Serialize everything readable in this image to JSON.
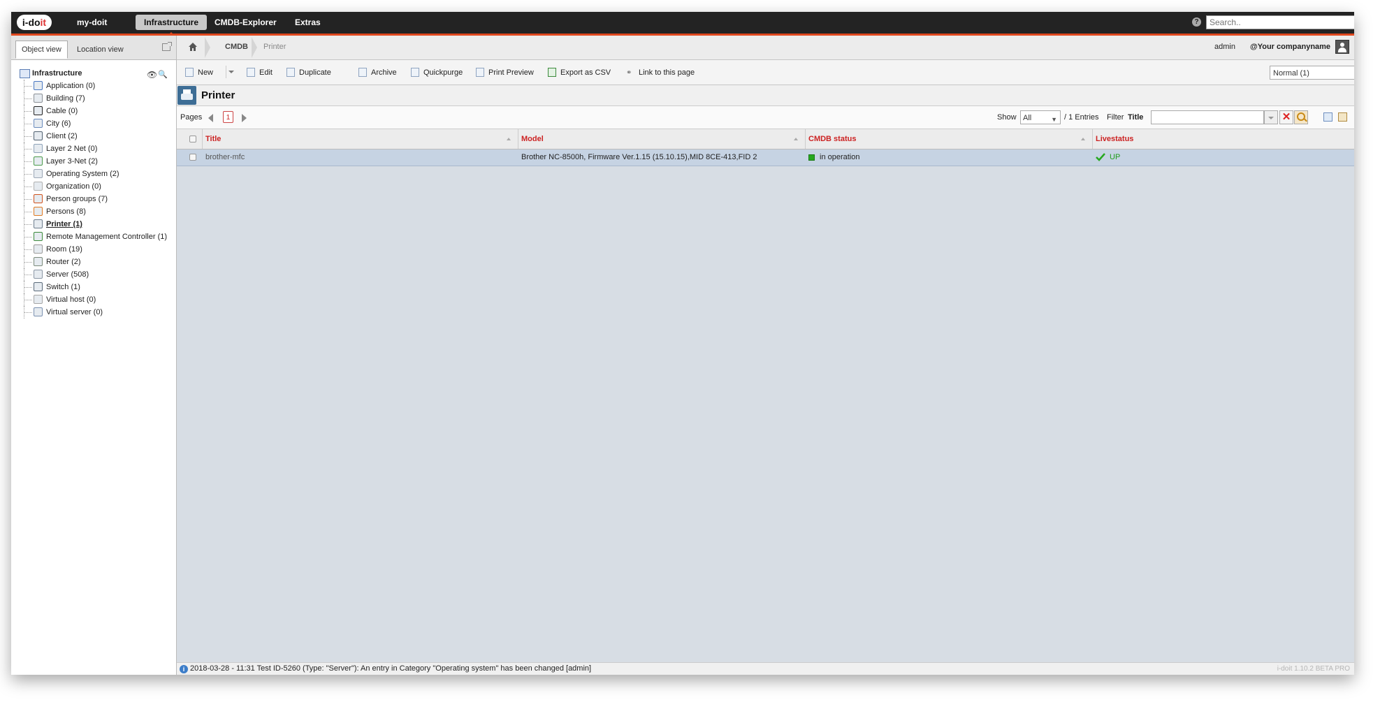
{
  "topbar": {
    "logo_prefix": "i-do",
    "logo_suffix": "it",
    "nav": [
      {
        "label": "my-doit"
      },
      {
        "label": "Infrastructure"
      },
      {
        "label": "CMDB-Explorer"
      },
      {
        "label": "Extras"
      }
    ],
    "help_glyph": "?",
    "search_placeholder": "Search.."
  },
  "left_panel": {
    "tabs": [
      "Object view",
      "Location view"
    ],
    "tree_root": "Infrastructure",
    "items": [
      {
        "label": "Application (0)",
        "color": "#4a78c2"
      },
      {
        "label": "Building (7)",
        "color": "#8a8f95"
      },
      {
        "label": "Cable (0)",
        "color": "#222222"
      },
      {
        "label": "City (6)",
        "color": "#6a8bbd"
      },
      {
        "label": "Client (2)",
        "color": "#506070"
      },
      {
        "label": "Layer 2 Net (0)",
        "color": "#8fa3b8"
      },
      {
        "label": "Layer 3-Net (2)",
        "color": "#4a9a4a"
      },
      {
        "label": "Operating System (2)",
        "color": "#9aa6b5"
      },
      {
        "label": "Organization (0)",
        "color": "#b0b0b0"
      },
      {
        "label": "Person groups (7)",
        "color": "#d0521c"
      },
      {
        "label": "Persons (8)",
        "color": "#e07a22"
      },
      {
        "label": "Printer (1)",
        "color": "#6c7c8c"
      },
      {
        "label": "Remote Management Controller (1)",
        "color": "#3a8a3a"
      },
      {
        "label": "Room (19)",
        "color": "#9a9a9a"
      },
      {
        "label": "Router (2)",
        "color": "#7a8a7a"
      },
      {
        "label": "Server (508)",
        "color": "#8a96a4"
      },
      {
        "label": "Switch (1)",
        "color": "#5a6a7a"
      },
      {
        "label": "Virtual host (0)",
        "color": "#a5a5a5"
      },
      {
        "label": "Virtual server (0)",
        "color": "#7a90b0"
      }
    ],
    "active_item": "Printer (1)"
  },
  "breadcrumb": {
    "items": [
      "CMDB",
      "Printer"
    ],
    "user": "admin",
    "company": "@Your companyname"
  },
  "toolbar": {
    "new": "New",
    "edit": "Edit",
    "duplicate": "Duplicate",
    "archive": "Archive",
    "quickpurge": "Quickpurge",
    "print_preview": "Print Preview",
    "export_csv": "Export as CSV",
    "link": "Link to this page",
    "view_mode": "Normal (1)"
  },
  "page": {
    "title": "Printer"
  },
  "pager": {
    "pages_label": "Pages",
    "current_page": "1",
    "show_label": "Show",
    "show_value": "All",
    "entries": "/ 1 Entries",
    "filter_label": "Filter",
    "filter_field": "Title",
    "filter_value": ""
  },
  "table": {
    "columns": [
      "Title",
      "Model",
      "CMDB status",
      "Livestatus"
    ],
    "rows": [
      {
        "title": "brother-mfc",
        "model": "Brother NC-8500h, Firmware Ver.1.15 (15.10.15),MID 8CE-413,FID 2",
        "cmdb_status": "in operation",
        "livestatus": "UP"
      }
    ]
  },
  "statusbar": {
    "message": "2018-03-28 - 11:31 Test ID-5260 (Type: \"Server\"): An entry in Category \"Operating system\" has been changed [admin]",
    "version": "i-doit 1.10.2 BETA PRO"
  },
  "colors": {
    "accent": "#e0481e",
    "header_text": "#cc2222",
    "status_green": "#27a820"
  }
}
